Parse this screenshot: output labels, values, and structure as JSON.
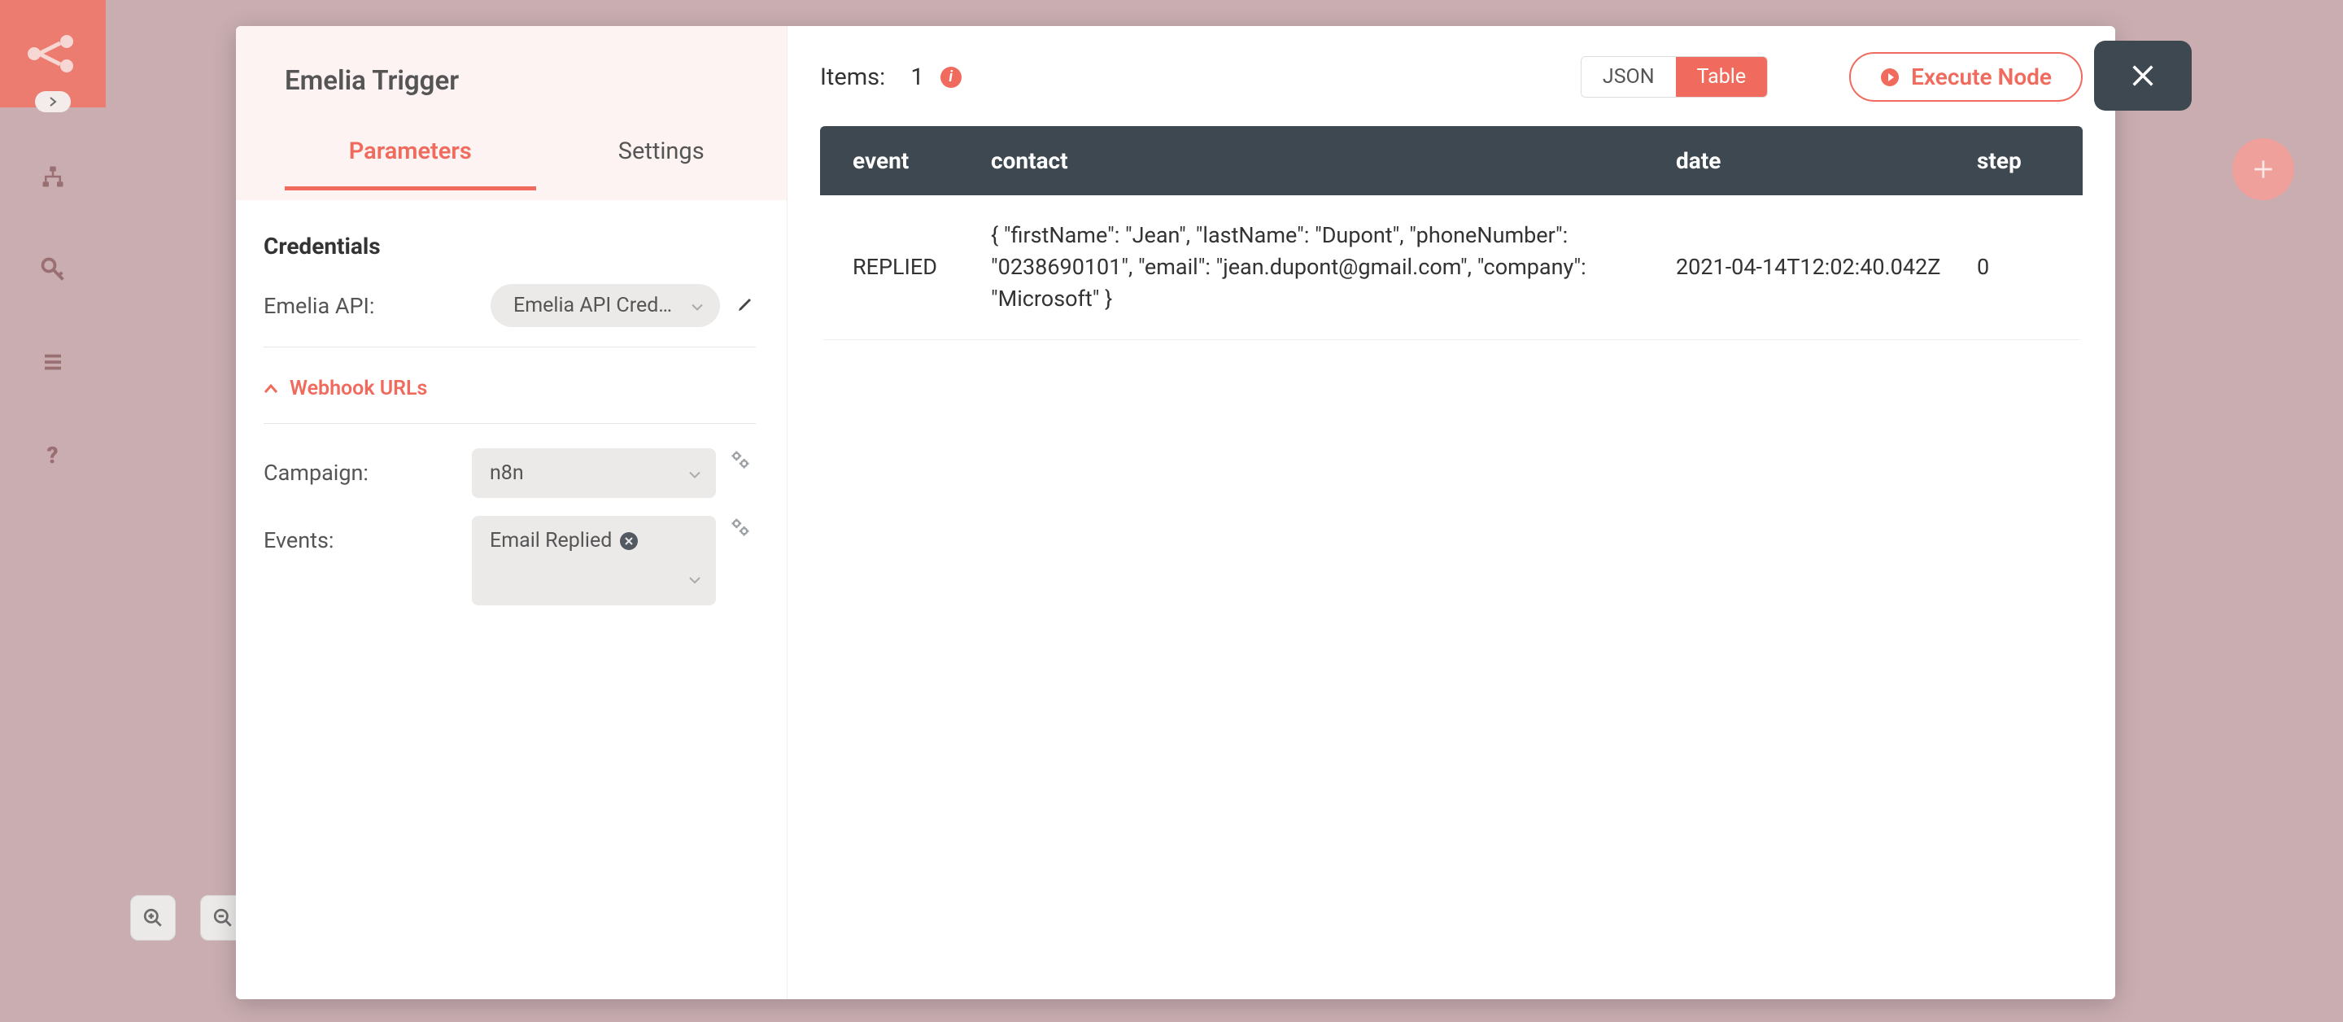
{
  "node": {
    "title": "Emelia Trigger",
    "tabs": {
      "parameters": "Parameters",
      "settings": "Settings",
      "active": "parameters"
    }
  },
  "credentials": {
    "heading": "Credentials",
    "label": "Emelia API:",
    "value": "Emelia API Creden …"
  },
  "webhook": {
    "label": "Webhook URLs"
  },
  "params": {
    "campaign": {
      "label": "Campaign:",
      "value": "n8n"
    },
    "events": {
      "label": "Events:",
      "tags": [
        "Email Replied"
      ]
    }
  },
  "right": {
    "items_label": "Items:",
    "items_count": "1",
    "view": {
      "json": "JSON",
      "table": "Table",
      "active": "table"
    },
    "execute": "Execute Node"
  },
  "table": {
    "headers": {
      "event": "event",
      "contact": "contact",
      "date": "date",
      "step": "step"
    },
    "rows": [
      {
        "event": "REPLIED",
        "contact": "{ \"firstName\": \"Jean\", \"lastName\": \"Dupont\", \"phoneNumber\": \"0238690101\", \"email\": \"jean.dupont@gmail.com\", \"company\": \"Microsoft\" }",
        "date": "2021-04-14T12:02:40.042Z",
        "step": "0"
      }
    ]
  },
  "colors": {
    "accent": "#f06b5d"
  }
}
